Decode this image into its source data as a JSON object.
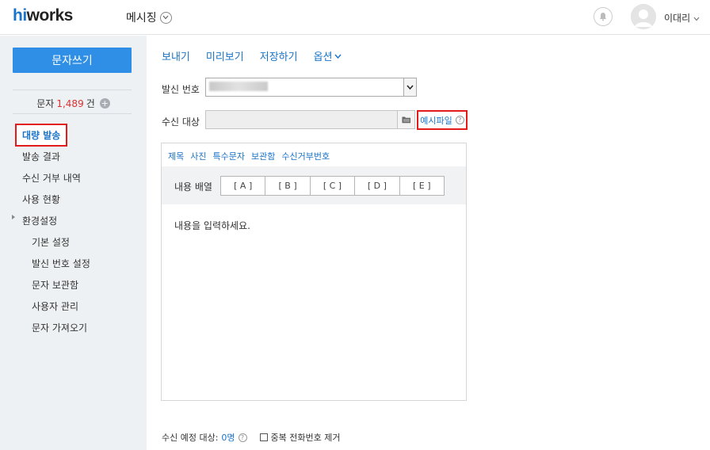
{
  "header": {
    "logo_hi": "hi",
    "logo_works": "works",
    "app_title": "메시징",
    "user_name": "이대리"
  },
  "sidebar": {
    "compose_label": "문자쓰기",
    "sms_label": "문자",
    "sms_count": "1,489",
    "sms_unit": "건",
    "plus": "+",
    "items": [
      {
        "label": "대량 발송"
      },
      {
        "label": "발송 결과"
      },
      {
        "label": "수신 거부 내역"
      },
      {
        "label": "사용 현황"
      },
      {
        "label": "환경설정"
      },
      {
        "label": "기본 설정"
      },
      {
        "label": "발신 번호 설정"
      },
      {
        "label": "문자 보관함"
      },
      {
        "label": "사용자 관리"
      },
      {
        "label": "문자 가져오기"
      }
    ]
  },
  "toolbar": {
    "send": "보내기",
    "preview": "미리보기",
    "save": "저장하기",
    "options": "옵션"
  },
  "form": {
    "sender_label": "발신 번호",
    "sender_value": "080-7700-1888",
    "recipient_label": "수신 대상",
    "sample_file": "예시파일",
    "help": "?"
  },
  "editor": {
    "tabs": [
      "제목",
      "사진",
      "특수문자",
      "보관함",
      "수신거부번호"
    ],
    "arrange_label": "내용 배열",
    "arrange_buttons": [
      "[ A ]",
      "[ B ]",
      "[ C ]",
      "[ D ]",
      "[ E ]"
    ],
    "placeholder": "내용을 입력하세요."
  },
  "footer": {
    "expected_label": "수신 예정 대상:",
    "expected_count": "0명",
    "help": "?",
    "dedupe_label": "중복 전화번호 제거"
  },
  "colors": {
    "accent": "#2f8ee5",
    "link": "#1a73c8",
    "highlight": "#e21b1b",
    "count": "#e0302f"
  }
}
